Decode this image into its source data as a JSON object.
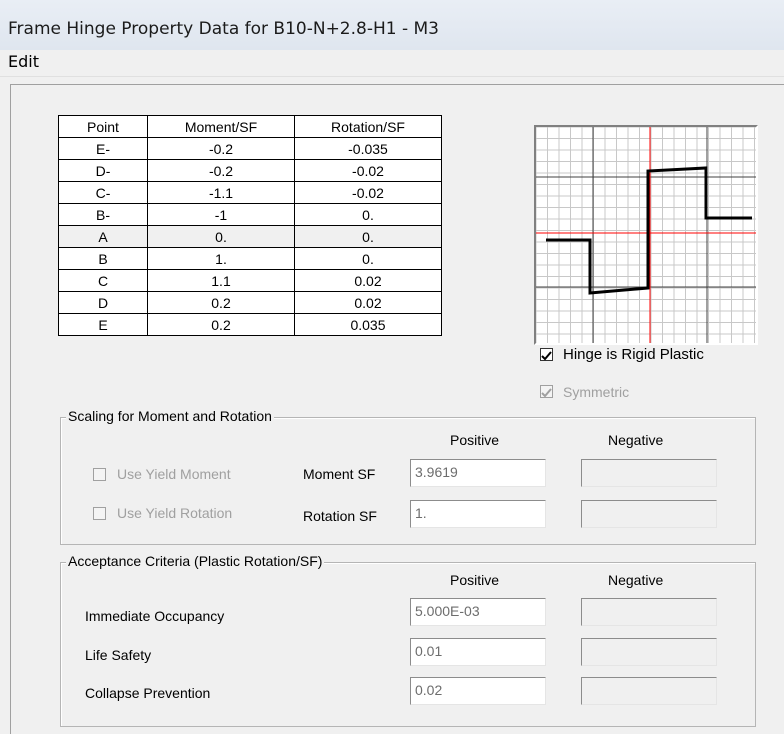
{
  "window": {
    "title": "Frame Hinge Property Data for B10-N+2.8-H1 - M3"
  },
  "menu": {
    "edit": "Edit"
  },
  "table": {
    "headers": [
      "Point",
      "Moment/SF",
      "Rotation/SF"
    ],
    "rows": [
      [
        "E-",
        "-0.2",
        "-0.035"
      ],
      [
        "D-",
        "-0.2",
        "-0.02"
      ],
      [
        "C-",
        "-1.1",
        "-0.02"
      ],
      [
        "B-",
        "-1",
        "0."
      ],
      [
        "A",
        "0.",
        "0."
      ],
      [
        "B",
        "1.",
        "0."
      ],
      [
        "C",
        "1.1",
        "0.02"
      ],
      [
        "D",
        "0.2",
        "0.02"
      ],
      [
        "E",
        "0.2",
        "0.035"
      ]
    ]
  },
  "options": {
    "rigid_plastic": {
      "label": "Hinge is Rigid Plastic",
      "checked": true
    },
    "symmetric": {
      "label": "Symmetric",
      "checked": true,
      "enabled": false
    }
  },
  "scaling": {
    "legend": "Scaling for Moment and Rotation",
    "positive_header": "Positive",
    "negative_header": "Negative",
    "use_yield_moment": "Use Yield Moment",
    "use_yield_rotation": "Use Yield Rotation",
    "moment_sf_label": "Moment SF",
    "moment_sf_value": "3.9619",
    "rotation_sf_label": "Rotation SF",
    "rotation_sf_value": "1."
  },
  "acceptance": {
    "legend": "Acceptance Criteria (Plastic Rotation/SF)",
    "positive_header": "Positive",
    "negative_header": "Negative",
    "io_label": "Immediate Occupancy",
    "io_value": "5.000E-03",
    "ls_label": "Life Safety",
    "ls_value": "0.01",
    "cp_label": "Collapse Prevention",
    "cp_value": "0.02"
  },
  "colors": {
    "axis": "#ff0000",
    "curve": "#000000",
    "grid": "#c0c0c0"
  }
}
